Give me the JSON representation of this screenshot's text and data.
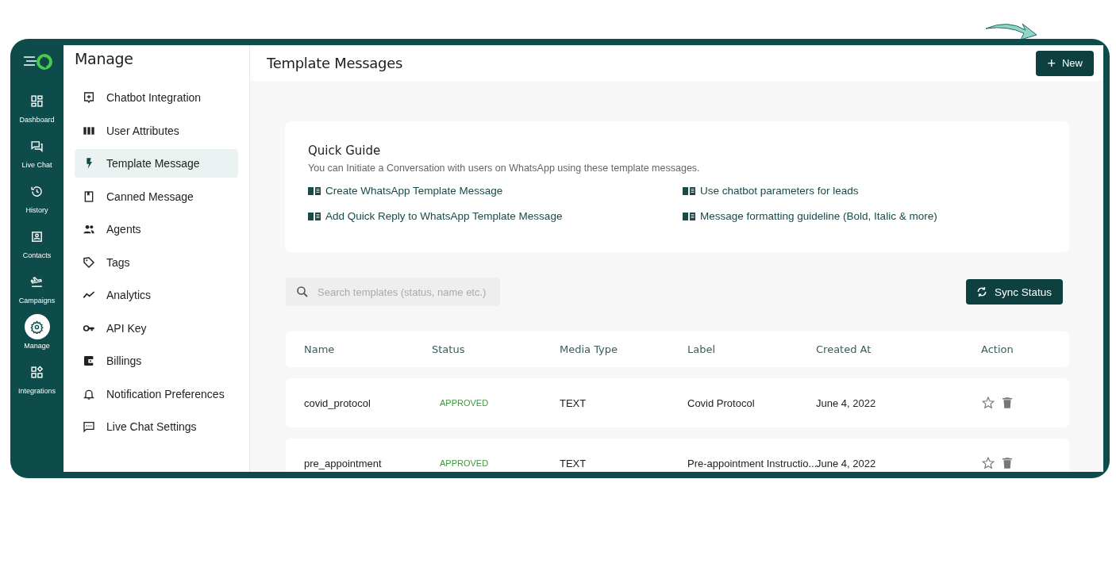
{
  "nav_rail": [
    {
      "label": "Dashboard",
      "selected": false
    },
    {
      "label": "Live Chat",
      "selected": false
    },
    {
      "label": "History",
      "selected": false
    },
    {
      "label": "Contacts",
      "selected": false
    },
    {
      "label": "Campaigns",
      "selected": false
    },
    {
      "label": "Manage",
      "selected": true
    },
    {
      "label": "Integrations",
      "selected": false
    }
  ],
  "sidebar": {
    "title": "Manage",
    "items": [
      {
        "label": "Chatbot Integration",
        "selected": false
      },
      {
        "label": "User Attributes",
        "selected": false
      },
      {
        "label": "Template Message",
        "selected": true
      },
      {
        "label": "Canned Message",
        "selected": false
      },
      {
        "label": "Agents",
        "selected": false
      },
      {
        "label": "Tags",
        "selected": false
      },
      {
        "label": "Analytics",
        "selected": false
      },
      {
        "label": "API Key",
        "selected": false
      },
      {
        "label": "Billings",
        "selected": false
      },
      {
        "label": "Notification Preferences",
        "selected": false
      },
      {
        "label": "Live Chat Settings",
        "selected": false
      }
    ]
  },
  "header": {
    "title": "Template Messages",
    "new_button": {
      "icon": "+",
      "label": "New"
    }
  },
  "quick_guide": {
    "title": "Quick Guide",
    "description": "You can Initiate a Conversation with users on WhatsApp using these template messages.",
    "links": [
      "Create WhatsApp Template Message",
      "Use chatbot parameters for leads",
      "Add Quick Reply to WhatsApp Template Message",
      "Message formatting guideline (Bold, Italic & more)"
    ]
  },
  "search": {
    "placeholder": "Search templates (status, name etc.)"
  },
  "sync_button": {
    "label": "Sync Status"
  },
  "table": {
    "columns": [
      "Name",
      "Status",
      "Media Type",
      "Label",
      "Created At",
      "Action"
    ],
    "rows": [
      {
        "name": "covid_protocol",
        "status": "APPROVED",
        "color": "#3b9a3b",
        "media_type": "TEXT",
        "label": "Covid Protocol",
        "created_at": "June 4, 2022",
        "starred": false
      },
      {
        "name": "pre_appointment",
        "status": "APPROVED",
        "color": "#3b9a3b",
        "media_type": "TEXT",
        "label": "Pre-appointment Instructio...",
        "created_at": "June 4, 2022",
        "starred": false
      }
    ]
  }
}
